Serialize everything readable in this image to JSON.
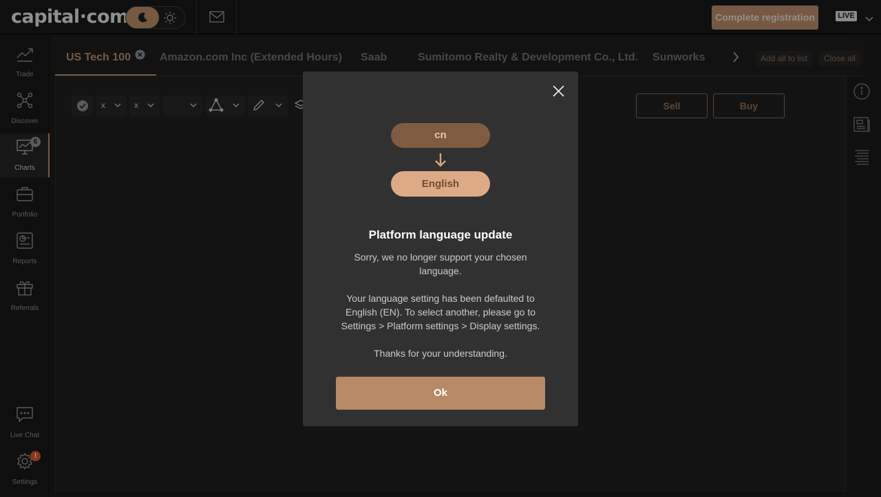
{
  "brand": {
    "logo": "capital·com"
  },
  "header": {
    "register_label": "Complete registration",
    "mode_badge": "LIVE"
  },
  "sidebar": {
    "items": [
      {
        "label": "Trade"
      },
      {
        "label": "Discover"
      },
      {
        "label": "Charts",
        "badge": "6"
      },
      {
        "label": "Portfolio"
      },
      {
        "label": "Reports"
      },
      {
        "label": "Referrals"
      },
      {
        "label": "Live Chat"
      },
      {
        "label": "Settings",
        "badge": "!"
      }
    ]
  },
  "tabs": {
    "items": [
      {
        "label": "US Tech 100"
      },
      {
        "label": "Amazon.com Inc (Extended Hours)"
      },
      {
        "label": "Saab"
      },
      {
        "label": "Sumitomo Realty & Development Co., Ltd."
      },
      {
        "label": "Sunworks"
      }
    ],
    "add_all_label": "Add all to list",
    "close_all_label": "Close all"
  },
  "toolbar": {
    "dropdown1": "x",
    "dropdown2": "x"
  },
  "trade": {
    "sell_label": "Sell",
    "buy_label": "Buy"
  },
  "modal": {
    "from_language": "cn",
    "to_language": "English",
    "title": "Platform language update",
    "para1": "Sorry, we no longer support your chosen language.",
    "para2": "Your language setting has been defaulted to English (EN). To select another, please go to Settings > Platform settings > Display settings.",
    "para3": "Thanks for your understanding.",
    "ok_label": "Ok"
  },
  "colors": {
    "accent": "#b4896a",
    "background": "#1b1b1b",
    "modal_bg": "#313131"
  }
}
